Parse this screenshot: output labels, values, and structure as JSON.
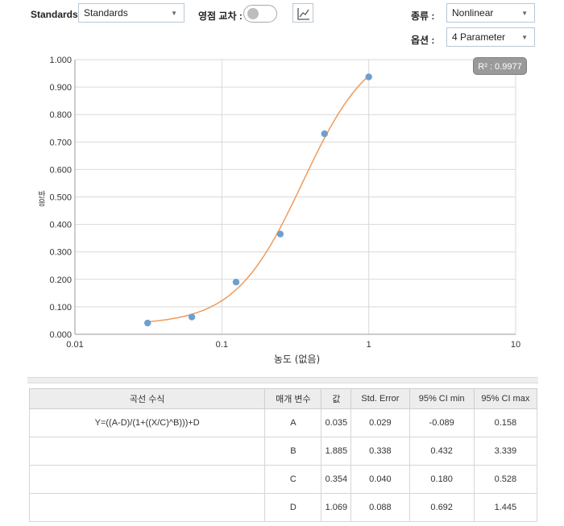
{
  "toolbar": {
    "standards_label": "Standards",
    "standards_value": "Standards",
    "zero_cross_label": "영점 교차 :",
    "type_label": "종류 :",
    "type_value": "Nonlinear",
    "option_label": "옵션 :",
    "option_value": "4 Parameter"
  },
  "r2_badge": "R² : 0.9977",
  "chart_data": {
    "type": "scatter",
    "xlabel": "농도 (없음)",
    "ylabel": "반응",
    "x_scale": "log",
    "xlim": [
      0.01,
      10
    ],
    "ylim": [
      0,
      1
    ],
    "x_ticks": [
      "0.01",
      "0.1",
      "1",
      "10"
    ],
    "y_ticks": [
      "0.000",
      "0.100",
      "0.200",
      "0.300",
      "0.400",
      "0.500",
      "0.600",
      "0.700",
      "0.800",
      "0.900",
      "1.000"
    ],
    "grid": true,
    "series": [
      {
        "kind": "points",
        "color": "#6f9fcf",
        "x": [
          0.03125,
          0.0625,
          0.125,
          0.25,
          0.5,
          1.0
        ],
        "y": [
          0.041,
          0.063,
          0.19,
          0.365,
          0.73,
          0.937
        ]
      },
      {
        "kind": "fit_curve",
        "color": "#ee9a5a",
        "model": "4PL",
        "params": {
          "A": 0.035,
          "B": 1.885,
          "C": 0.354,
          "D": 1.069
        },
        "x_range": [
          0.03125,
          1.0
        ]
      }
    ]
  },
  "table": {
    "headers": [
      "곡선 수식",
      "매개 변수",
      "값",
      "Std. Error",
      "95% CI min",
      "95% CI max"
    ],
    "formula": "Y=((A-D)/(1+((X/C)^B)))+D",
    "rows": [
      [
        "A",
        "0.035",
        "0.029",
        "-0.089",
        "0.158"
      ],
      [
        "B",
        "1.885",
        "0.338",
        "0.432",
        "3.339"
      ],
      [
        "C",
        "0.354",
        "0.040",
        "0.180",
        "0.528"
      ],
      [
        "D",
        "1.069",
        "0.088",
        "0.692",
        "1.445"
      ]
    ]
  }
}
